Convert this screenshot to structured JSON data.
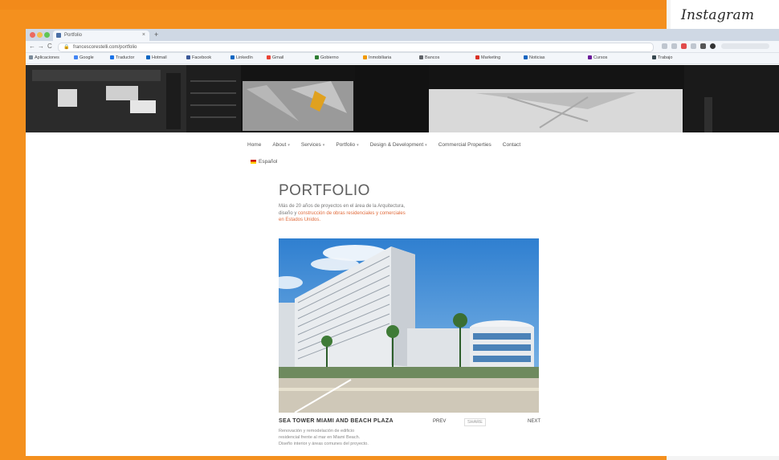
{
  "instagram": {
    "logo_text": "Instagram"
  },
  "browser": {
    "tab_title": "Portfolio",
    "tab_close": "×",
    "new_tab": "+",
    "url": "francescorestelli.com/portfolio",
    "back": "←",
    "forward": "→",
    "reload": "C",
    "bookmarks": [
      "Aplicaciones",
      "Google",
      "Traductor",
      "Hotmail",
      "Facebook",
      "LinkedIn",
      "Gmail",
      "Gobierno",
      "Inmobiliaria",
      "Bancos",
      "Marketing",
      "Noticias",
      "Cursos",
      "Trabajo"
    ]
  },
  "site": {
    "nav": [
      {
        "label": "Home",
        "has_arrow": false
      },
      {
        "label": "About",
        "has_arrow": true
      },
      {
        "label": "Services",
        "has_arrow": true
      },
      {
        "label": "Portfolio",
        "has_arrow": true
      },
      {
        "label": "Design & Development",
        "has_arrow": true
      },
      {
        "label": "Commercial Properties",
        "has_arrow": false
      },
      {
        "label": "Contact",
        "has_arrow": false
      }
    ],
    "language": "Español"
  },
  "portfolio": {
    "title": "PORTFOLIO",
    "desc_line1": "Más de 20 años de proyectos en el área de la Arquitectura,",
    "desc_line2_pre": "diseño y",
    "desc_link": "construcción de obras residenciales y comerciales",
    "desc_line3": "en Estados Unidos.",
    "item_title": "SEA TOWER MIAMI AND BEACH PLAZA",
    "prev": "PREV",
    "share": "SHARE",
    "next": "NEXT",
    "caption_lines": [
      "Renovación y remodelación de edificio",
      "residencial frente al mar en Miami Beach.",
      "Diseño interior y áreas comunes del proyecto."
    ]
  }
}
